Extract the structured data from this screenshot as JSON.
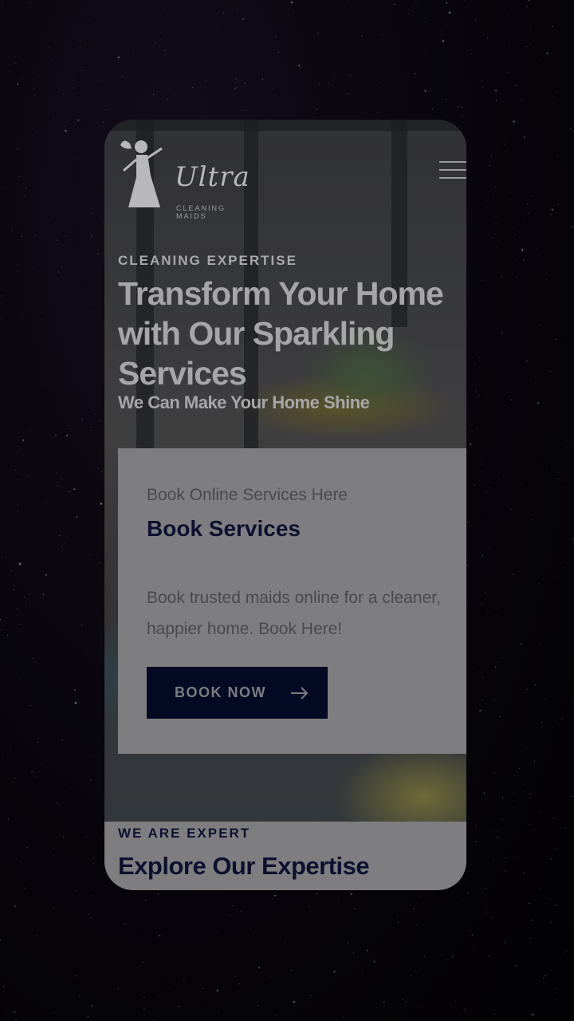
{
  "header": {
    "logo_script": "Ultra",
    "logo_subtitle": "CLEANING MAIDS",
    "menu_icon": "hamburger-menu-icon"
  },
  "hero": {
    "eyebrow": "CLEANING EXPERTISE",
    "headline": "Transform Your Home with Our Sparkling Services",
    "subheadline": "We Can Make Your Home Shine"
  },
  "booking_card": {
    "eyebrow": "Book Online Services Here",
    "title": "Book Services",
    "body": "Book trusted maids online for a cleaner, happier home. Book Here!",
    "button_label": "BOOK NOW",
    "button_icon": "arrow-right-icon"
  },
  "expertise": {
    "eyebrow": "WE ARE EXPERT",
    "title": "Explore Our Expertise"
  },
  "colors": {
    "navy": "#050a24",
    "card_bg": "#7e7e80",
    "backdrop": "#050308"
  }
}
